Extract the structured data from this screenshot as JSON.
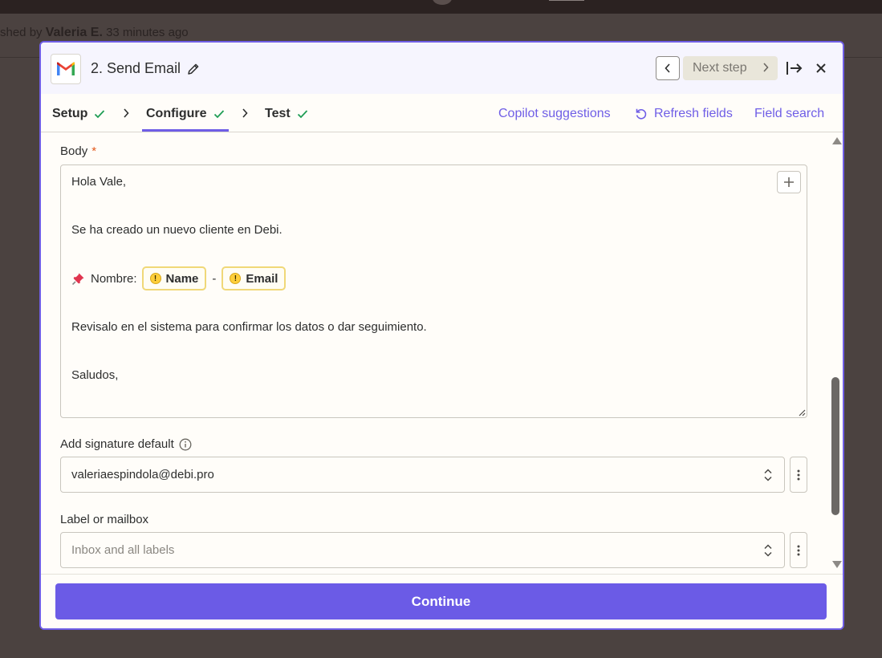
{
  "background": {
    "published_prefix": "shed by",
    "published_user": "Valeria E.",
    "published_time": "33 minutes ago"
  },
  "modal": {
    "app_icon": "gmail-icon",
    "step_title": "2. Send Email",
    "next_step_label": "Next step",
    "tabs": [
      {
        "label": "Setup",
        "done": true
      },
      {
        "label": "Configure",
        "done": true,
        "active": true
      },
      {
        "label": "Test",
        "done": true
      }
    ],
    "links": {
      "copilot": "Copilot suggestions",
      "refresh": "Refresh fields",
      "field_search": "Field search"
    },
    "body_field": {
      "label": "Body",
      "required_mark": "*",
      "line1": "Hola Vale,",
      "line2": "Se ha creado un nuevo cliente en Debi.",
      "line3_prefix": "Nombre:",
      "pill_name": "Name",
      "pill_separator": "-",
      "pill_email": "Email",
      "warn_mark": "!",
      "line4": "Revisalo en el sistema para confirmar los datos o dar seguimiento.",
      "line5": "Saludos,"
    },
    "signature_field": {
      "label": "Add signature default",
      "value": "valeriaespindola@debi.pro"
    },
    "label_field": {
      "label": "Label or mailbox",
      "placeholder": "Inbox and all labels"
    },
    "continue_label": "Continue"
  },
  "colors": {
    "accent": "#6b5be6",
    "check": "#1f9d55",
    "required": "#e25a1c",
    "pill_border": "#f0d878"
  }
}
